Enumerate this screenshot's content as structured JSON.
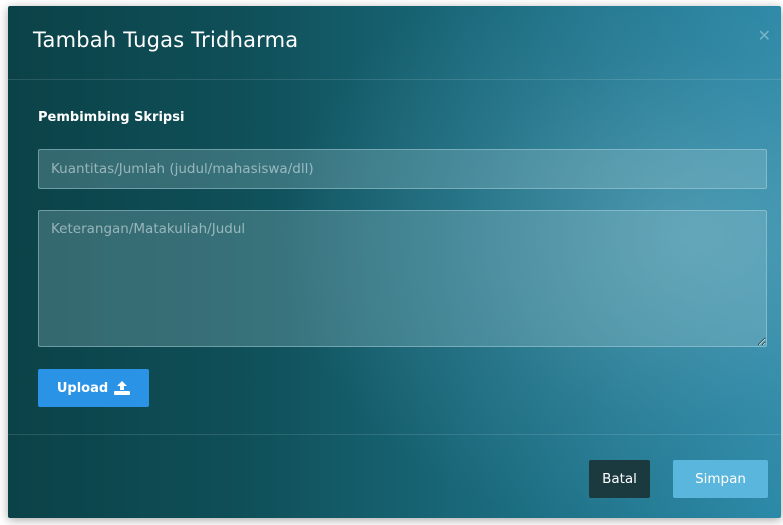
{
  "modal": {
    "title": "Tambah Tugas Tridharma",
    "close_icon": "close-icon",
    "section_label": "Pembimbing Skripsi",
    "quantity_input": {
      "value": "",
      "placeholder": "Kuantitas/Jumlah (judul/mahasiswa/dll)"
    },
    "description_textarea": {
      "value": "",
      "placeholder": "Keterangan/Matakuliah/Judul"
    },
    "upload_button": {
      "label": "Upload",
      "icon": "upload-icon"
    },
    "footer": {
      "cancel_label": "Batal",
      "save_label": "Simpan"
    }
  },
  "colors": {
    "modal_gradient_start": "#0b4248",
    "modal_gradient_end": "#2a89a8",
    "upload_button": "#2a93e6",
    "cancel_button": "#1b3a40",
    "save_button": "#5ab6dc"
  }
}
